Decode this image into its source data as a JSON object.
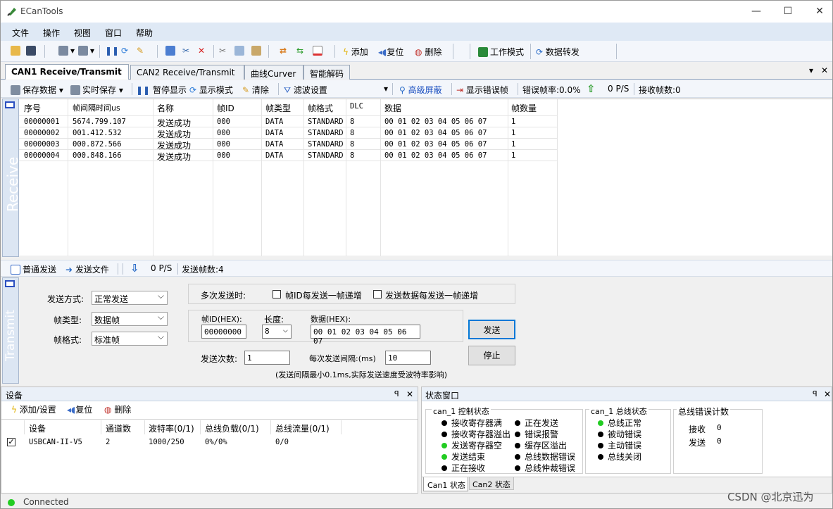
{
  "window": {
    "title": "ECanTools",
    "min": "—",
    "max": "☐",
    "close": "✕"
  },
  "menu": [
    "文件",
    "操作",
    "视图",
    "窗口",
    "帮助"
  ],
  "toolbar": {
    "add": "添加",
    "reset": "复位",
    "delete": "删除",
    "work_mode": "工作模式",
    "data_forward": "数据转发"
  },
  "tabs": [
    "CAN1 Receive/Transmit",
    "CAN2 Receive/Transmit",
    "曲线Curver",
    "智能解码"
  ],
  "tab_controls": {
    "dropdown": "▾",
    "close": "✕"
  },
  "receive_toolbar": {
    "save_data": "保存数据",
    "realtime_save": "实时保存",
    "pause_display": "暂停显示",
    "display_mode": "显示模式",
    "clear": "清除",
    "filter_settings": "滤波设置",
    "advanced_mask": "高级屏蔽",
    "show_error_frames": "显示错误帧",
    "error_rate": "错误帧率:0.0%",
    "rate": "0 P/S",
    "received_count": "接收帧数:0"
  },
  "receive_side_label": "Receive",
  "receive_table": {
    "headers": [
      "序号",
      "帧间隔时间us",
      "名称",
      "帧ID",
      "帧类型",
      "帧格式",
      "DLC",
      "数据",
      "帧数量"
    ],
    "rows": [
      [
        "00000001",
        "5674.799.107",
        "发送成功",
        "000",
        "DATA",
        "STANDARD",
        "8",
        "00 01 02 03 04 05 06 07",
        "1"
      ],
      [
        "00000002",
        "001.412.532",
        "发送成功",
        "000",
        "DATA",
        "STANDARD",
        "8",
        "00 01 02 03 04 05 06 07",
        "1"
      ],
      [
        "00000003",
        "000.872.566",
        "发送成功",
        "000",
        "DATA",
        "STANDARD",
        "8",
        "00 01 02 03 04 05 06 07",
        "1"
      ],
      [
        "00000004",
        "000.848.166",
        "发送成功",
        "000",
        "DATA",
        "STANDARD",
        "8",
        "00 01 02 03 04 05 06 07",
        "1"
      ]
    ]
  },
  "transmit_toolbar": {
    "normal_send": "普通发送",
    "send_file": "发送文件",
    "rate": "0 P/S",
    "sent_count": "发送帧数:4"
  },
  "transmit_side_label": "Transmit",
  "transmit": {
    "send_mode_label": "发送方式:",
    "send_mode": "正常发送",
    "frame_type_label": "帧类型:",
    "frame_type": "数据帧",
    "frame_format_label": "帧格式:",
    "frame_format": "标准帧",
    "multi_send_label": "多次发送时:",
    "inc_id_label": "帧ID每发送一帧递增",
    "inc_data_label": "发送数据每发送一帧递增",
    "frame_id_label": "帧ID(HEX):",
    "frame_id": "00000000",
    "length_label": "长度:",
    "length": "8",
    "data_label": "数据(HEX):",
    "data": "00 01 02 03 04 05 06 07",
    "send_count_label": "发送次数:",
    "send_count": "1",
    "interval_label": "每次发送间隔:(ms)",
    "interval": "10",
    "note": "(发送间隔最小0.1ms,实际发送速度受波特率影响)",
    "send_button": "发送",
    "stop_button": "停止"
  },
  "device_panel": {
    "title": "设备",
    "pin": "ꟼ",
    "close": "✕",
    "add": "添加/设置",
    "reset": "复位",
    "delete": "删除",
    "headers": [
      "设备",
      "通道数",
      "波特率(0/1)",
      "总线负载(0/1)",
      "总线流量(0/1)"
    ],
    "rows": [
      [
        "USBCAN-II-V5",
        "2",
        "1000/250",
        "0%/0%",
        "0/0"
      ]
    ]
  },
  "status_panel": {
    "title": "状态窗口",
    "pin": "ꟼ",
    "close": "✕",
    "control_title": "can_1 控制状态",
    "control_left": [
      [
        "接收寄存器满",
        "#000000"
      ],
      [
        "接收寄存器溢出",
        "#000000"
      ],
      [
        "发送寄存器空",
        "#22cc22"
      ],
      [
        "发送结束",
        "#22cc22"
      ],
      [
        "正在接收",
        "#000000"
      ]
    ],
    "control_right": [
      [
        "正在发送",
        "#000000"
      ],
      [
        "错误报警",
        "#000000"
      ],
      [
        "缓存区溢出",
        "#000000"
      ],
      [
        "总线数据错误",
        "#000000"
      ],
      [
        "总线仲裁错误",
        "#000000"
      ]
    ],
    "bus_title": "can_1 总线状态",
    "bus": [
      [
        "总线正常",
        "#22cc22"
      ],
      [
        "被动错误",
        "#000000"
      ],
      [
        "主动错误",
        "#000000"
      ],
      [
        "总线关闭",
        "#000000"
      ]
    ],
    "err_title": "总线错误计数",
    "rx_label": "接收",
    "rx_value": "0",
    "tx_label": "发送",
    "tx_value": "0",
    "tabs": [
      "Can1 状态",
      "Can2 状态"
    ]
  },
  "statusbar": {
    "text": "Connected"
  },
  "watermark": "CSDN @北京迅为"
}
